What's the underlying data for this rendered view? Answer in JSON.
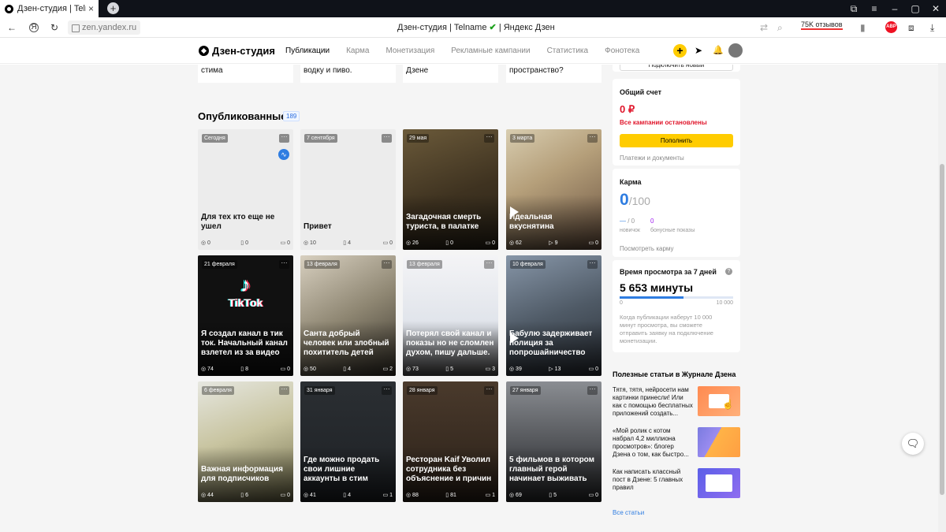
{
  "browser": {
    "tab_title": "Дзен-студия | Telname",
    "tab_close": "×",
    "new_tab": "+",
    "url": "zen.yandex.ru",
    "page_title": "Дзен-студия | Telname",
    "page_title_suffix": "| Яндекс Дзен",
    "reviews": "75K отзывов",
    "abp": "ABP"
  },
  "header": {
    "logo": "Дзен-студия",
    "nav": [
      "Публикации",
      "Карма",
      "Монетизация",
      "Рекламные кампании",
      "Статистика",
      "Фонотека"
    ]
  },
  "drafts": [
    {
      "title": "продавая аккаунты стима"
    },
    {
      "title": "курить? Или как не пить водку и пиво."
    },
    {
      "title": "получается на Яндекс Дзене"
    },
    {
      "title": "четырехмерное пространство?"
    }
  ],
  "published": {
    "title": "Опубликованные",
    "count": "189",
    "cards": [
      {
        "date": "Сегодня",
        "title": "Для тех кто еще не ушел",
        "views": "0",
        "reads": "0",
        "comments": "0",
        "style": "light"
      },
      {
        "date": "7 сентября",
        "title": "Привет",
        "views": "10",
        "reads": "4",
        "comments": "0",
        "style": "light"
      },
      {
        "date": "29 мая",
        "title": "Загадочная смерть туриста, в палатке",
        "views": "26",
        "reads": "0",
        "comments": "0",
        "style": "dark"
      },
      {
        "date": "3 марта",
        "title": "Идеальная вкуснятина",
        "views": "62",
        "reads": "9",
        "comments": "0",
        "style": "video"
      },
      {
        "date": "21 февраля",
        "title": "Я создал канал в тик ток. Начальный канал взлетел из за видео",
        "views": "74",
        "reads": "8",
        "comments": "0",
        "style": "tiktok"
      },
      {
        "date": "13 февраля",
        "title": "Санта добрый человек или злобный похититель детей",
        "views": "50",
        "reads": "4",
        "comments": "2",
        "style": "dark"
      },
      {
        "date": "13 февраля",
        "title": "Потерял свой канал и показы но не сломлен духом, пишу дальше.",
        "views": "73",
        "reads": "5",
        "comments": "3",
        "style": "dark"
      },
      {
        "date": "10 февраля",
        "title": "Бабулю задерживает полиция за попрошайничество",
        "views": "39",
        "reads": "13",
        "comments": "0",
        "style": "video"
      },
      {
        "date": "6 февраля",
        "title": "Важная информация для подписчиков",
        "views": "44",
        "reads": "6",
        "comments": "0",
        "style": "dark"
      },
      {
        "date": "31 января",
        "title": "Где можно продать свои лишние аккаунты в стим",
        "views": "41",
        "reads": "4",
        "comments": "1",
        "style": "dark"
      },
      {
        "date": "28 января",
        "title": "Ресторан Kaif Уволил сотрудника без объяснение и причин",
        "views": "88",
        "reads": "81",
        "comments": "1",
        "style": "dark"
      },
      {
        "date": "27 января",
        "title": "5 фильмов в котором главный герой начинает выживать",
        "views": "69",
        "reads": "5",
        "comments": "0",
        "style": "dark"
      }
    ]
  },
  "sidebar": {
    "connect_btn": "Подключить новый",
    "account": {
      "title": "Общий счет",
      "amount": "0 ₽",
      "stopped": "Все кампании остановлены",
      "topup": "Пополнить",
      "payments": "Платежи и документы"
    },
    "karma": {
      "title": "Карма",
      "value": "0",
      "max": "/100",
      "newbie_dash": "—",
      "newbie_val": "/ 0",
      "newbie_lbl": "новичок",
      "bonus_val": "0",
      "bonus_lbl": "бонусные показы",
      "link": "Посмотреть карму"
    },
    "watch": {
      "title": "Время просмотра за 7 дней",
      "value": "5 653 минуты",
      "min": "0",
      "max": "10 000",
      "progress": 0.565,
      "help": "?",
      "note": "Когда публикации наберут 10 000 минут просмотра, вы сможете отправить заявку на подключение монетизации."
    },
    "journal": {
      "title": "Полезные статьи в Журнале Дзена",
      "articles": [
        {
          "text": "Тятя, тятя, нейросети нам картинки принесли! Или как с помощью бесплатных приложений создать..."
        },
        {
          "text": "«Мой ролик с котом набрал 4,2 миллиона просмотров»: блогер Дзена о том, как быстро..."
        },
        {
          "text": "Как написать классный пост в Дзене: 5 главных правил"
        }
      ],
      "all": "Все статьи"
    }
  }
}
